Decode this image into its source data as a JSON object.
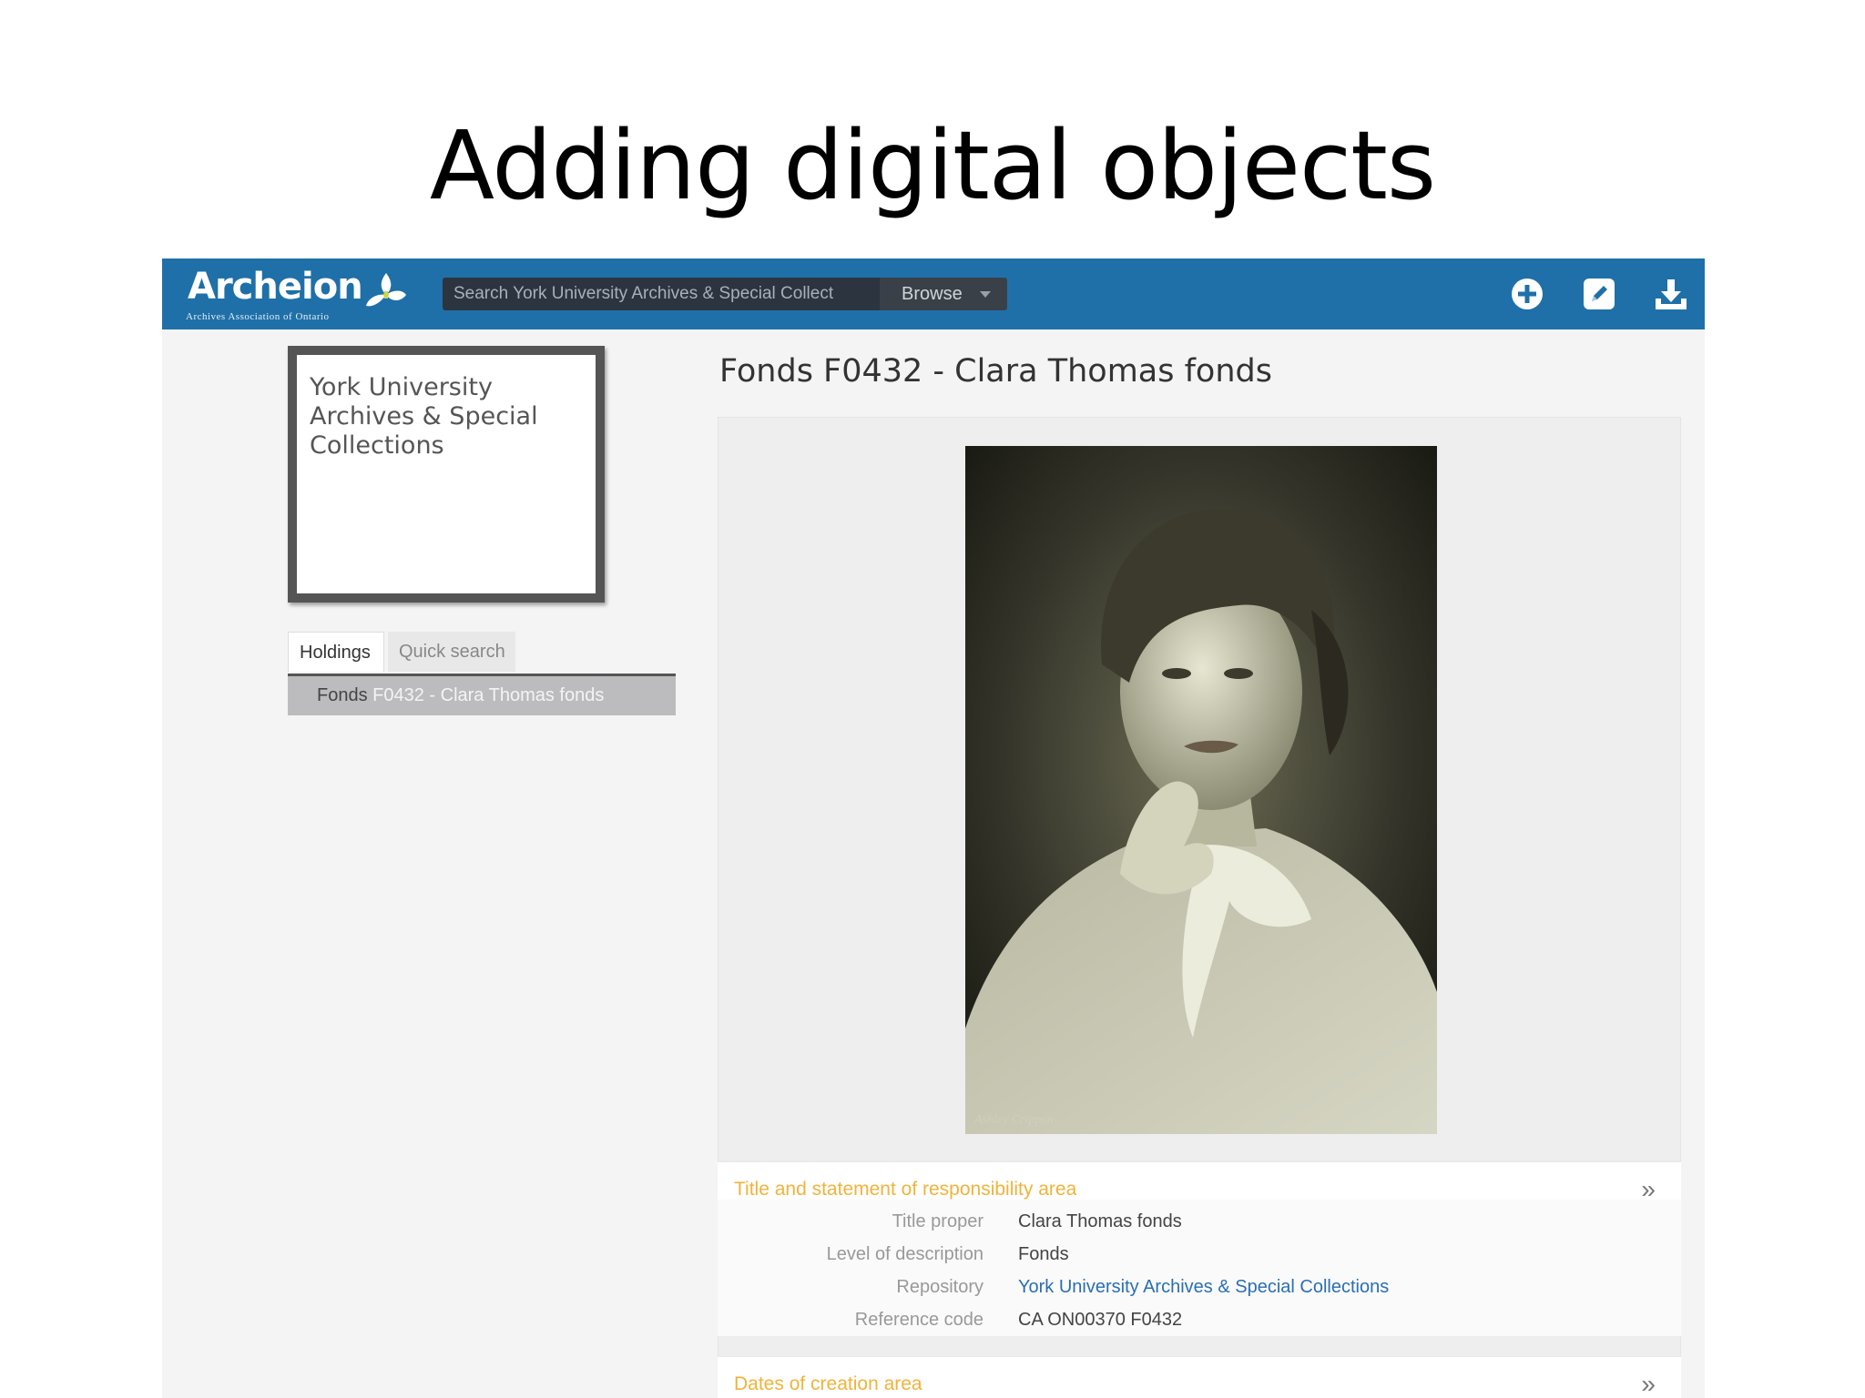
{
  "slide": {
    "title": "Adding digital objects"
  },
  "app": {
    "logo_text": "Archeion",
    "logo_subtitle": "Archives Association of Ontario",
    "search_placeholder": "Search York University Archives & Special Collect",
    "browse_label": "Browse",
    "toolbar_icons": [
      "add-circle-icon",
      "edit-icon",
      "download-icon"
    ],
    "brand_color": "#1f70a8"
  },
  "sidebar": {
    "repository_logo_text": "York University Archives & Special Collections",
    "tabs": [
      {
        "label": "Holdings",
        "active": true
      },
      {
        "label": "Quick search",
        "active": false
      }
    ],
    "tree": {
      "level": "Fonds",
      "title": "F0432 - Clara Thomas fonds"
    }
  },
  "record": {
    "title": "Fonds F0432 - Clara Thomas fonds",
    "image_signature": "Ashley Crippen",
    "sections": [
      {
        "label": "Title and statement of responsibility area",
        "chevron": "»"
      },
      {
        "label": "Dates of creation area",
        "chevron": "»"
      }
    ],
    "fields": [
      {
        "label": "Title proper",
        "value": "Clara Thomas fonds"
      },
      {
        "label": "Level of description",
        "value": "Fonds"
      },
      {
        "label": "Repository",
        "value": "York University Archives & Special Collections"
      },
      {
        "label": "Reference code",
        "value": "CA ON00370 F0432"
      }
    ],
    "accent_color": "#f0b33a"
  }
}
